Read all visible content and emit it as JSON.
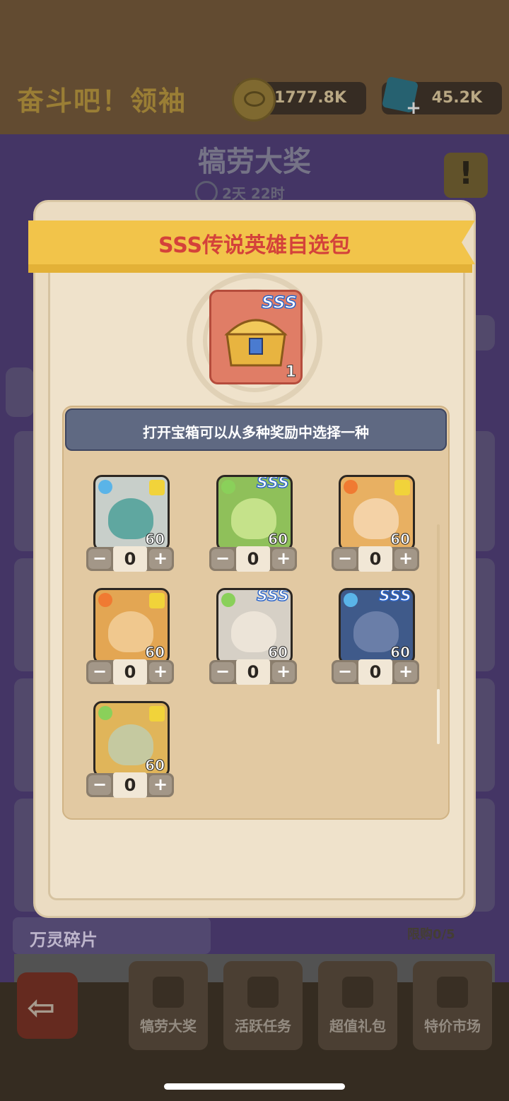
{
  "header": {
    "game_title": "奋斗吧！领袖",
    "coins": "1777.8K",
    "gems": "45.2K"
  },
  "event": {
    "title": "犒劳大奖",
    "timer": "2天 22时"
  },
  "background": {
    "section_title": "万灵碎片",
    "limit": "限购0/5"
  },
  "nav": {
    "tabs": [
      {
        "label": "犒劳大奖"
      },
      {
        "label": "活跃任务"
      },
      {
        "label": "超值礼包"
      },
      {
        "label": "特价市场"
      }
    ]
  },
  "dialog": {
    "title": "SSS传说英雄自选包",
    "chest": {
      "rank": "SSS",
      "count": "1"
    },
    "instruction": "打开宝箱可以从多种奖励中选择一种",
    "heroes": [
      {
        "element": "water",
        "rank": "",
        "level": "60",
        "qty": "0",
        "bg": "#c8cfca",
        "face": "#5fa7a0",
        "elem_color": "#5ab4e8"
      },
      {
        "element": "wood",
        "rank": "SSS",
        "level": "60",
        "qty": "0",
        "bg": "#8fc05a",
        "face": "#c5e28a",
        "elem_color": "#8ad05a"
      },
      {
        "element": "fire",
        "rank": "",
        "level": "60",
        "qty": "0",
        "bg": "#e8b062",
        "face": "#f4d2a6",
        "elem_color": "#f07a32"
      },
      {
        "element": "fire",
        "rank": "",
        "level": "60",
        "qty": "0",
        "bg": "#e3a653",
        "face": "#f0c88e",
        "elem_color": "#f07a32"
      },
      {
        "element": "wood",
        "rank": "SSS",
        "level": "60",
        "qty": "0",
        "bg": "#d6d0c6",
        "face": "#ece4d8",
        "elem_color": "#8ad05a"
      },
      {
        "element": "water",
        "rank": "SSS",
        "level": "60",
        "qty": "0",
        "bg": "#3f5a8a",
        "face": "#6a7ea8",
        "elem_color": "#5ab4e8"
      },
      {
        "element": "wood",
        "rank": "",
        "level": "60",
        "qty": "0",
        "bg": "#e0b55a",
        "face": "#c5c9a0",
        "elem_color": "#8ad05a"
      }
    ],
    "minus": "−",
    "plus": "+"
  }
}
